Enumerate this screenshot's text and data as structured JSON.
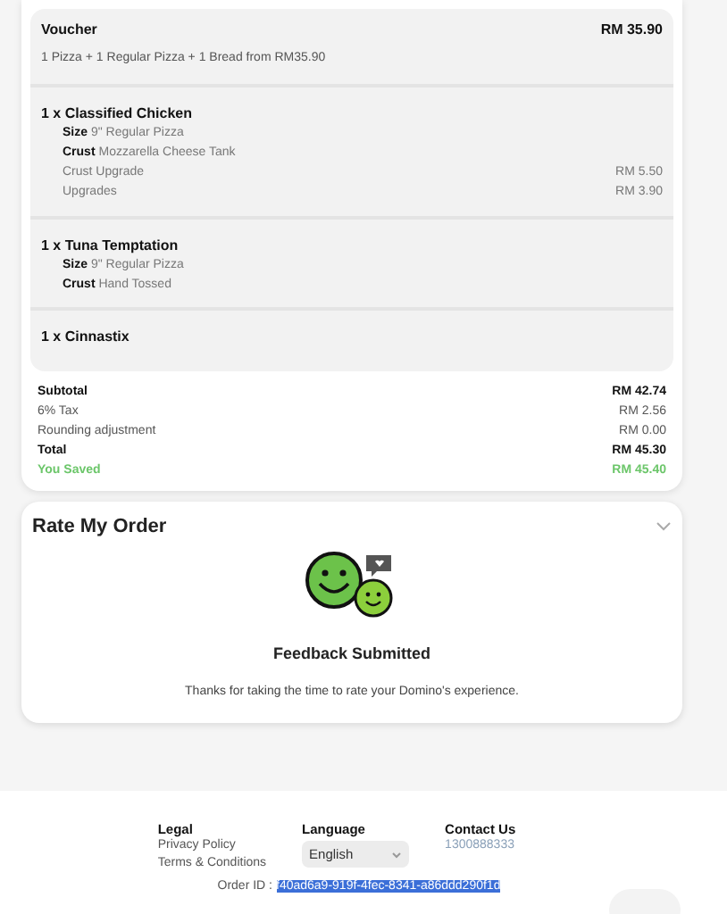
{
  "voucher": {
    "title": "Voucher",
    "description": "1 Pizza + 1 Regular Pizza + 1 Bread from RM35.90",
    "price": "RM 35.90"
  },
  "items": [
    {
      "name": "1 x Classified Chicken",
      "options": [
        {
          "kind": "option",
          "label": "Size",
          "value": "9\" Regular Pizza"
        },
        {
          "kind": "option",
          "label": "Crust",
          "value": "Mozzarella Cheese Tank"
        },
        {
          "kind": "charge",
          "label": "Crust Upgrade",
          "value": "RM 5.50"
        },
        {
          "kind": "charge",
          "label": "Upgrades",
          "value": "RM 3.90"
        }
      ]
    },
    {
      "name": "1 x Tuna Temptation",
      "options": [
        {
          "kind": "option",
          "label": "Size",
          "value": "9\" Regular Pizza"
        },
        {
          "kind": "option",
          "label": "Crust",
          "value": "Hand Tossed"
        }
      ]
    },
    {
      "name": "1 x Cinnastix"
    }
  ],
  "totals": [
    {
      "kind": "bold",
      "label": "Subtotal",
      "value": "RM 42.74"
    },
    {
      "kind": "plain",
      "label": "6% Tax",
      "value": "RM 2.56"
    },
    {
      "kind": "plain",
      "label": "Rounding adjustment",
      "value": "RM 0.00"
    },
    {
      "kind": "bold",
      "label": "Total",
      "value": "RM 45.30"
    },
    {
      "kind": "saved",
      "label": "You Saved",
      "value": "RM 45.40"
    }
  ],
  "rating": {
    "title": "Rate My Order",
    "expanded": true,
    "status": "Feedback Submitted",
    "message": "Thanks for taking the time to rate your Domino's experience."
  },
  "footer": {
    "legal": {
      "title": "Legal",
      "links": [
        "Privacy Policy",
        "Terms & Conditions"
      ]
    },
    "language": {
      "title": "Language",
      "value": "English"
    },
    "contact": {
      "title": "Contact Us",
      "phone": "1300888333"
    },
    "order_id_label": "Order ID :",
    "order_id": "f40ad6a9-919f-4fec-8341-a86ddd290f1d"
  }
}
